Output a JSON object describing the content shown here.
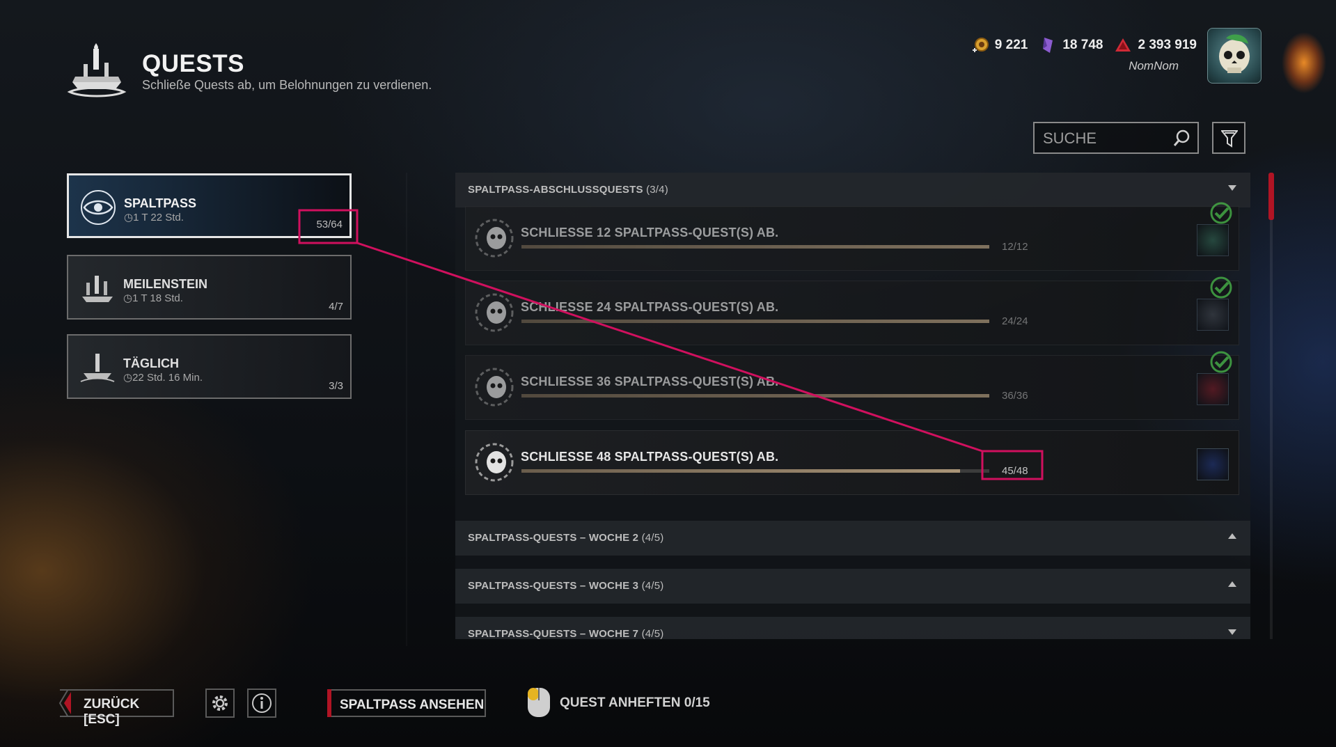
{
  "header": {
    "title": "QUESTS",
    "subtitle": "Schließe Quests ab, um Belohnungen zu verdienen.",
    "logo_icon": "candle-altar-icon"
  },
  "currencies": [
    {
      "name": "bloodpoints",
      "icon": "bloodpoint-coin-icon",
      "value": "9 221",
      "color": "#e0a030"
    },
    {
      "name": "iridescent-shards",
      "icon": "shard-icon",
      "value": "18 748",
      "color": "#9a6fd0"
    },
    {
      "name": "auric-cells",
      "icon": "auric-cell-icon",
      "value": "2 393 919",
      "color": "#d0303a"
    }
  ],
  "player": {
    "name": "NomNom",
    "avatar_icon": "skull-avatar-icon"
  },
  "search": {
    "placeholder": "SUCHE",
    "value": ""
  },
  "categories": [
    {
      "name": "SPALTPASS",
      "time": "1 T 22 Std.",
      "progress": "53/64",
      "active": true,
      "icon": "rift-eye-icon"
    },
    {
      "name": "MEILENSTEIN",
      "time": "1 T 18 Std.",
      "progress": "4/7",
      "active": false,
      "icon": "candles-icon"
    },
    {
      "name": "TÄGLICH",
      "time": "22 Std. 16 Min.",
      "progress": "3/3",
      "active": false,
      "icon": "altar-icon"
    }
  ],
  "sections": [
    {
      "title": "SPALTPASS-ABSCHLUSSQUESTS",
      "count": "(3/4)",
      "expanded": true
    },
    {
      "title": "SPALTPASS-QUESTS – WOCHE 2",
      "count": "(4/5)",
      "expanded": false
    },
    {
      "title": "SPALTPASS-QUESTS – WOCHE 3",
      "count": "(4/5)",
      "expanded": false
    },
    {
      "title": "SPALTPASS-QUESTS – WOCHE 7",
      "count": "(4/5)",
      "expanded": false
    }
  ],
  "quests": [
    {
      "title": "SCHLIESSE 12 SPALTPASS-QUEST(S) AB.",
      "progress": "12/12",
      "fraction": 1.0,
      "completed": true,
      "reward_color": "#2d5a4a"
    },
    {
      "title": "SCHLIESSE 24 SPALTPASS-QUEST(S) AB.",
      "progress": "24/24",
      "fraction": 1.0,
      "completed": true,
      "reward_color": "#3a3f46"
    },
    {
      "title": "SCHLIESSE 36 SPALTPASS-QUEST(S) AB.",
      "progress": "36/36",
      "fraction": 1.0,
      "completed": true,
      "reward_color": "#6a1a22"
    },
    {
      "title": "SCHLIESSE 48 SPALTPASS-QUEST(S) AB.",
      "progress": "45/48",
      "fraction": 0.9375,
      "completed": false,
      "reward_color": "#1c2a55"
    }
  ],
  "footer": {
    "back_label": "ZURÜCK [ESC]",
    "view_rift_label": "SPALTPASS ANSEHEN",
    "pin_label": "QUEST ANHEFTEN 0/15"
  },
  "colors": {
    "accent_red": "#b01424",
    "highlight_pink": "#d0105e",
    "check_green": "#4cc14a"
  }
}
